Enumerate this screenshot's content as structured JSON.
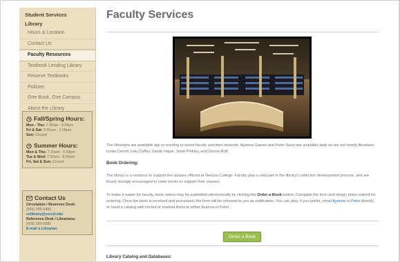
{
  "sidebar": {
    "section_student": "Student Services",
    "section_library": "Library",
    "items": [
      {
        "label": "Hours & Location"
      },
      {
        "label": "Contact Us"
      },
      {
        "label": "Faculty Resources",
        "active": true
      },
      {
        "label": "Textbook Lending Library"
      },
      {
        "label": "Reserve Textbooks"
      },
      {
        "label": "Policies"
      },
      {
        "label": "One Book, One Campus"
      },
      {
        "label": "About the Library"
      }
    ]
  },
  "hours_fall": {
    "title": "Fall/Spring Hours:",
    "rows": [
      {
        "days": "Mon - Thu:",
        "time": "7:30am - 9:00pm"
      },
      {
        "days": "Fri & Sat:",
        "time": "9:00am - 1:00pm"
      },
      {
        "days": "Sun:",
        "time": "Closed"
      }
    ]
  },
  "hours_summer": {
    "title": "Summer Hours:",
    "rows": [
      {
        "days": "Mon & Thu:",
        "time": "7:30am - 5:30pm"
      },
      {
        "days": "Tue & Wed:",
        "time": "7:30am - 8:00pm"
      },
      {
        "days": "Fri, Sat & Sun:",
        "time": "Closed"
      }
    ]
  },
  "contact": {
    "title": "Contact Us",
    "circ_label": "Circulation / Reserves Desk:",
    "circ_phone": "(805) 289-6482",
    "circ_email": "vclibrary@vcccd.edu",
    "ref_label": "Reference Desk / Librarians:",
    "ref_phone": "(805) 289-6882",
    "ref_email": "E-mail a Librarian"
  },
  "main": {
    "title": "Faculty Services",
    "intro": "The librarians are available day or evening to assist faculty and their students. Ayanna Gaines and Peter Sezzi are available daily as are our hourly librarians Linda Carroll, Lulu Coffey, Sandy Hajas, Janet Pinkley, and Donna Roff.",
    "book_ordering_heading": "Book Ordering:",
    "book_ordering_text": "The library is a resource to support the classes offered at Ventura College. Faculty play a vital part in the library's collection development process, and are thusly strongly encouraged to order books to support their classes.",
    "order_p1": "To make it easier for faculty, book orders may be submitted electronically by clicking the ",
    "order_p1_em": "Order a Book",
    "order_p2": " button. Complete the form and simply press submit for ordering. Once the book is received and processed, the form will be returned to you as notification. You can also, if you prefer, email ",
    "order_link_ayanna": "Ayanna",
    "order_or": " or ",
    "order_link_peter": "Peter",
    "order_p3": " directly, or hand a catalog with circled or marked items to either Ayanna or Peter.",
    "order_button": "Order a Book",
    "catalog_heading": "Library Catalog and Databases:"
  },
  "colors": {
    "sidebar_bg": "#ede0c2",
    "link": "#1c6fb0",
    "button": "#9bbf4d"
  }
}
